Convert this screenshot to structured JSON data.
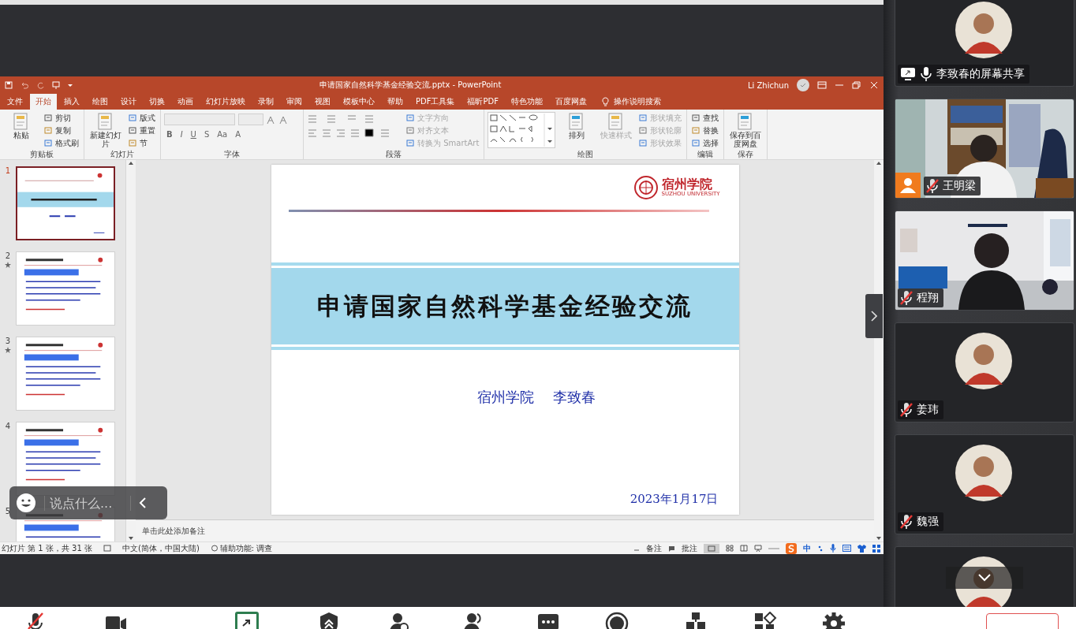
{
  "ppt": {
    "title": "申请国家自然科学基金经验交流.pptx  -  PowerPoint",
    "user": "Li Zhichun",
    "tabs": [
      {
        "label": "文件",
        "selected": false
      },
      {
        "label": "开始",
        "selected": true
      },
      {
        "label": "插入",
        "selected": false
      },
      {
        "label": "绘图",
        "selected": false
      },
      {
        "label": "设计",
        "selected": false
      },
      {
        "label": "切换",
        "selected": false
      },
      {
        "label": "动画",
        "selected": false
      },
      {
        "label": "幻灯片放映",
        "selected": false
      },
      {
        "label": "录制",
        "selected": false
      },
      {
        "label": "审阅",
        "selected": false
      },
      {
        "label": "视图",
        "selected": false
      },
      {
        "label": "模板中心",
        "selected": false
      },
      {
        "label": "帮助",
        "selected": false
      },
      {
        "label": "PDF工具集",
        "selected": false
      },
      {
        "label": "福昕PDF",
        "selected": false
      },
      {
        "label": "特色功能",
        "selected": false
      },
      {
        "label": "百度网盘",
        "selected": false
      }
    ],
    "tell_me": "操作说明搜索",
    "ribbon": [
      {
        "label": "剪贴板",
        "kind": "basic",
        "items": [
          {
            "label": "粘贴",
            "kind": "large",
            "disabled": false
          },
          {
            "label": "剪切",
            "kind": "small",
            "disabled": false
          },
          {
            "label": "复制",
            "kind": "small",
            "disabled": false
          },
          {
            "label": "格式刷",
            "kind": "small",
            "disabled": false
          }
        ]
      },
      {
        "label": "幻灯片",
        "kind": "basic",
        "items": [
          {
            "label": "新建幻灯片",
            "kind": "large",
            "disabled": false
          },
          {
            "label": "版式",
            "kind": "small",
            "disabled": false
          },
          {
            "label": "重置",
            "kind": "small",
            "disabled": false
          },
          {
            "label": "节",
            "kind": "small",
            "disabled": false
          }
        ]
      },
      {
        "label": "字体",
        "kind": "font",
        "items": [
          {
            "label": "B",
            "kind": "char",
            "disabled": false
          },
          {
            "label": "I",
            "kind": "char",
            "disabled": false
          },
          {
            "label": "U",
            "kind": "char",
            "disabled": false
          },
          {
            "label": "S",
            "kind": "char",
            "disabled": false
          },
          {
            "label": "Aa",
            "kind": "char",
            "disabled": false
          },
          {
            "label": "A",
            "kind": "char",
            "disabled": false
          }
        ]
      },
      {
        "label": "段落",
        "kind": "paragraph",
        "items": [
          {
            "label": "文字方向",
            "kind": "small",
            "disabled": true
          },
          {
            "label": "对齐文本",
            "kind": "small",
            "disabled": true
          },
          {
            "label": "转换为 SmartArt",
            "kind": "small",
            "disabled": true
          }
        ]
      },
      {
        "label": "绘图",
        "kind": "drawing",
        "items": [
          {
            "label": "排列",
            "kind": "large",
            "disabled": false
          },
          {
            "label": "快速样式",
            "kind": "large",
            "disabled": true
          },
          {
            "label": "形状填充",
            "kind": "small",
            "disabled": true
          },
          {
            "label": "形状轮廓",
            "kind": "small",
            "disabled": true
          },
          {
            "label": "形状效果",
            "kind": "small",
            "disabled": true
          }
        ]
      },
      {
        "label": "编辑",
        "kind": "basic",
        "items": [
          {
            "label": "查找",
            "kind": "small",
            "disabled": false
          },
          {
            "label": "替换",
            "kind": "small",
            "disabled": false
          },
          {
            "label": "选择",
            "kind": "small",
            "disabled": false
          }
        ]
      },
      {
        "label": "保存",
        "kind": "basic",
        "items": [
          {
            "label": "保存到百度网盘",
            "kind": "large",
            "disabled": false
          }
        ]
      }
    ],
    "thumbnails": [
      {
        "number": "1",
        "selected": true,
        "animated": false,
        "kind": "title"
      },
      {
        "number": "2",
        "selected": false,
        "animated": true,
        "kind": "content"
      },
      {
        "number": "3",
        "selected": false,
        "animated": true,
        "kind": "content"
      },
      {
        "number": "4",
        "selected": false,
        "animated": false,
        "kind": "content"
      },
      {
        "number": "5",
        "selected": false,
        "animated": false,
        "kind": "content"
      }
    ],
    "slide": {
      "logo_name": "宿州学院",
      "logo_subtitle": "SUZHOU UNIVERSITY",
      "title": "申请国家自然科学基金经验交流",
      "affiliation": "宿州学院",
      "author": "李致春",
      "date": "2023年1月17日"
    },
    "notes_placeholder": "单击此处添加备注",
    "status_bar": {
      "slide_count": "幻灯片 第 1 张，共 31 张",
      "language": "中文(简体，中国大陆)",
      "accessibility": "辅助功能: 调查",
      "notes": "备注",
      "comments": "批注",
      "ime": "中"
    }
  },
  "chat_overlay": {
    "placeholder": "说点什么..."
  },
  "participants": [
    {
      "name": "李致春的屏幕共享",
      "kind": "avatar",
      "sharing": true,
      "host": false,
      "muted": false
    },
    {
      "name": "王明梁",
      "kind": "video",
      "sharing": false,
      "host": true,
      "muted": true
    },
    {
      "name": "程翔",
      "kind": "video",
      "sharing": false,
      "host": false,
      "muted": true
    },
    {
      "name": "姜玮",
      "kind": "avatar",
      "sharing": false,
      "host": false,
      "muted": true
    },
    {
      "name": "魏强",
      "kind": "avatar",
      "sharing": false,
      "host": false,
      "muted": true
    },
    {
      "kind": "avatar"
    }
  ],
  "toolbar": [
    {
      "kind": "mic",
      "muted": true
    },
    {
      "kind": "camera"
    },
    {
      "kind": "share"
    },
    {
      "kind": "security"
    },
    {
      "kind": "invite"
    },
    {
      "kind": "members"
    },
    {
      "kind": "chat"
    },
    {
      "kind": "record"
    },
    {
      "kind": "layout"
    },
    {
      "kind": "apps"
    },
    {
      "kind": "settings"
    },
    {
      "kind": "end"
    }
  ]
}
